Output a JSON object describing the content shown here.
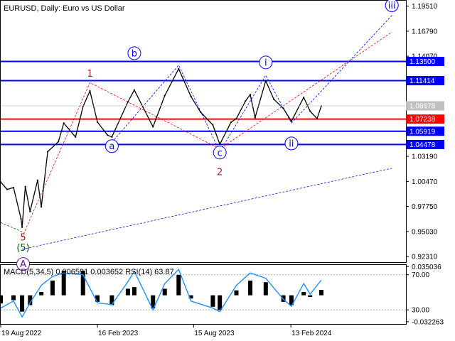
{
  "chart_data": [
    {
      "type": "line",
      "title": "EURUSD, Daily:  Euro vs US Dollar",
      "symbol": "EURUSD",
      "timeframe": "Daily",
      "description": "Euro vs US Dollar",
      "ylim": [
        0.917,
        1.201
      ],
      "x_start": "2022-08-19",
      "x_end": "2024-04-10",
      "y_ticks": [
        1.1951,
        1.1679,
        1.1407,
        1.1135,
        1.0863,
        1.0591,
        1.0319,
        1.0047,
        0.9775,
        0.9503,
        0.9231
      ],
      "x_ticks": [
        {
          "x": "2022-08-19",
          "label": "19 Aug 2022"
        },
        {
          "x": "2023-02-16",
          "label": "16 Feb 2023"
        },
        {
          "x": "2023-08-15",
          "label": "15 Aug 2023"
        },
        {
          "x": "2024-02-13",
          "label": "13 Feb 2024"
        }
      ],
      "price_series": [
        {
          "x": "2022-08-19",
          "y": 1.004
        },
        {
          "x": "2022-08-31",
          "y": 0.996
        },
        {
          "x": "2022-09-12",
          "y": 0.998
        },
        {
          "x": "2022-09-26",
          "y": 0.964
        },
        {
          "x": "2022-09-28",
          "y": 0.955
        },
        {
          "x": "2022-10-04",
          "y": 0.999
        },
        {
          "x": "2022-10-13",
          "y": 0.972
        },
        {
          "x": "2022-10-27",
          "y": 1.006
        },
        {
          "x": "2022-11-03",
          "y": 0.977
        },
        {
          "x": "2022-11-15",
          "y": 1.037
        },
        {
          "x": "2022-12-05",
          "y": 1.048
        },
        {
          "x": "2022-12-15",
          "y": 1.068
        },
        {
          "x": "2023-01-06",
          "y": 1.053
        },
        {
          "x": "2023-01-20",
          "y": 1.086
        },
        {
          "x": "2023-02-02",
          "y": 1.103
        },
        {
          "x": "2023-02-16",
          "y": 1.069
        },
        {
          "x": "2023-03-07",
          "y": 1.055
        },
        {
          "x": "2023-03-15",
          "y": 1.053
        },
        {
          "x": "2023-04-14",
          "y": 1.091
        },
        {
          "x": "2023-04-26",
          "y": 1.104
        },
        {
          "x": "2023-05-31",
          "y": 1.064
        },
        {
          "x": "2023-06-22",
          "y": 1.098
        },
        {
          "x": "2023-07-18",
          "y": 1.127
        },
        {
          "x": "2023-08-10",
          "y": 1.097
        },
        {
          "x": "2023-08-28",
          "y": 1.08
        },
        {
          "x": "2023-09-20",
          "y": 1.066
        },
        {
          "x": "2023-10-03",
          "y": 1.045
        },
        {
          "x": "2023-10-24",
          "y": 1.069
        },
        {
          "x": "2023-11-03",
          "y": 1.073
        },
        {
          "x": "2023-11-20",
          "y": 1.092
        },
        {
          "x": "2023-11-29",
          "y": 1.099
        },
        {
          "x": "2023-12-08",
          "y": 1.074
        },
        {
          "x": "2023-12-28",
          "y": 1.114
        },
        {
          "x": "2024-01-12",
          "y": 1.094
        },
        {
          "x": "2024-01-30",
          "y": 1.084
        },
        {
          "x": "2024-02-14",
          "y": 1.07
        },
        {
          "x": "2024-03-08",
          "y": 1.096
        },
        {
          "x": "2024-03-20",
          "y": 1.081
        },
        {
          "x": "2024-04-02",
          "y": 1.073
        },
        {
          "x": "2024-04-10",
          "y": 1.0867
        }
      ],
      "current_price": {
        "value": 1.08678,
        "label": "1.08678"
      },
      "levels": [
        {
          "value": 1.135,
          "label": "1.13500",
          "color": "#0000ff"
        },
        {
          "value": 1.11414,
          "label": "1.11414",
          "color": "#0000ff"
        },
        {
          "value": 1.07238,
          "label": "1.07238",
          "color": "#ff0000"
        },
        {
          "value": 1.05919,
          "label": "1.05919",
          "color": "#0000ff"
        },
        {
          "value": 1.04478,
          "label": "1.04478",
          "color": "#0000ff"
        }
      ],
      "wave_lines": [
        {
          "color": "#ff0000",
          "points": [
            [
              "2022-09-28",
              0.944
            ],
            [
              "2023-02-02",
              1.112
            ],
            [
              "2023-10-03",
              1.04
            ],
            [
              "2024-08-20",
              1.167
            ]
          ]
        },
        {
          "color": "#0000ff",
          "points": [
            [
              "2023-03-15",
              1.047
            ],
            [
              "2023-07-18",
              1.131
            ],
            [
              "2023-10-03",
              1.037
            ],
            [
              "2023-12-28",
              1.12
            ],
            [
              "2024-02-14",
              1.068
            ],
            [
              "2024-08-20",
              1.185
            ]
          ]
        },
        {
          "color": "#3300cc",
          "points": [
            [
              "2022-09-28",
              0.931
            ],
            [
              "2024-08-20",
              1.019
            ]
          ]
        },
        {
          "color": "#006400",
          "points": [
            [
              "2022-08-19",
              0.96
            ],
            [
              "2022-09-28",
              0.95
            ]
          ]
        }
      ],
      "wave_labels": [
        {
          "text": "1",
          "x": "2023-02-02",
          "y": 1.122,
          "color": "#b22222",
          "circled": false
        },
        {
          "text": "2",
          "x": "2023-10-03",
          "y": 1.015,
          "color": "#b22222",
          "circled": false
        },
        {
          "text": "5",
          "x": "2022-09-30",
          "y": 0.944,
          "color": "#b22222",
          "circled": false
        },
        {
          "text": "(5)",
          "x": "2022-09-30",
          "y": 0.933,
          "color": "#006400",
          "circled": false
        },
        {
          "text": "A",
          "x": "2022-09-30",
          "y": 0.915,
          "color": "#6a0dad",
          "circled": true
        },
        {
          "text": "a",
          "x": "2023-03-15",
          "y": 1.043,
          "color": "#0000ff",
          "circled": true
        },
        {
          "text": "b",
          "x": "2023-04-26",
          "y": 1.144,
          "color": "#0000ff",
          "circled": true
        },
        {
          "text": "c",
          "x": "2023-10-03",
          "y": 1.036,
          "color": "#0000ff",
          "circled": true
        },
        {
          "text": "i",
          "x": "2023-12-28",
          "y": 1.134,
          "color": "#0000ff",
          "circled": true
        },
        {
          "text": "ii",
          "x": "2024-02-14",
          "y": 1.046,
          "color": "#0000ff",
          "circled": true
        },
        {
          "text": "iii",
          "x": "2024-08-20",
          "y": 1.196,
          "color": "#0000ff",
          "circled": true
        }
      ]
    },
    {
      "type": "line",
      "title": "MACD(5,34,5) 0.006591 0.003652 RSI(14) 63.87",
      "macd_params": "MACD(5,34,5)",
      "macd_value": "0.006591",
      "signal_value": "0.003652",
      "rsi_params": "RSI(14)",
      "rsi_value": "63.87",
      "ylim": [
        -0.035,
        0.037
      ],
      "y_ticks": [
        {
          "value": 0.035036,
          "label": "0.035036"
        },
        {
          "value": 0.0251,
          "label": "70.00"
        },
        {
          "value": -0.0178,
          "label": "30.00"
        },
        {
          "value": -0.032263,
          "label": "-0.032263"
        }
      ],
      "macd_series": [
        {
          "x": "2022-08-19",
          "y": -0.01
        },
        {
          "x": "2022-09-12",
          "y": -0.006
        },
        {
          "x": "2022-09-28",
          "y": -0.02
        },
        {
          "x": "2022-10-13",
          "y": -0.012
        },
        {
          "x": "2022-11-03",
          "y": 0.004
        },
        {
          "x": "2022-11-24",
          "y": 0.018
        },
        {
          "x": "2022-12-15",
          "y": 0.03
        },
        {
          "x": "2023-01-20",
          "y": 0.03
        },
        {
          "x": "2023-02-16",
          "y": -0.008
        },
        {
          "x": "2023-03-15",
          "y": -0.012
        },
        {
          "x": "2023-04-14",
          "y": 0.008
        },
        {
          "x": "2023-04-26",
          "y": 0.01
        },
        {
          "x": "2023-05-31",
          "y": -0.016
        },
        {
          "x": "2023-06-22",
          "y": 0.008
        },
        {
          "x": "2023-07-18",
          "y": 0.025
        },
        {
          "x": "2023-08-10",
          "y": -0.004
        },
        {
          "x": "2023-09-20",
          "y": -0.014
        },
        {
          "x": "2023-10-03",
          "y": -0.018
        },
        {
          "x": "2023-11-03",
          "y": 0.006
        },
        {
          "x": "2023-11-29",
          "y": 0.018
        },
        {
          "x": "2023-12-28",
          "y": 0.016
        },
        {
          "x": "2024-01-30",
          "y": -0.008
        },
        {
          "x": "2024-02-14",
          "y": -0.012
        },
        {
          "x": "2024-03-08",
          "y": 0.004
        },
        {
          "x": "2024-03-20",
          "y": -0.002
        },
        {
          "x": "2024-04-10",
          "y": 0.0066
        }
      ],
      "rsi_series": [
        {
          "x": "2022-08-19",
          "y": 32
        },
        {
          "x": "2022-09-12",
          "y": 40
        },
        {
          "x": "2022-09-28",
          "y": 22
        },
        {
          "x": "2022-10-13",
          "y": 38
        },
        {
          "x": "2022-11-03",
          "y": 58
        },
        {
          "x": "2022-11-24",
          "y": 68
        },
        {
          "x": "2022-12-15",
          "y": 72
        },
        {
          "x": "2023-01-20",
          "y": 70
        },
        {
          "x": "2023-02-16",
          "y": 38
        },
        {
          "x": "2023-03-15",
          "y": 36
        },
        {
          "x": "2023-04-14",
          "y": 62
        },
        {
          "x": "2023-04-26",
          "y": 74
        },
        {
          "x": "2023-05-31",
          "y": 30
        },
        {
          "x": "2023-06-22",
          "y": 60
        },
        {
          "x": "2023-07-18",
          "y": 76
        },
        {
          "x": "2023-08-10",
          "y": 40
        },
        {
          "x": "2023-09-20",
          "y": 32
        },
        {
          "x": "2023-10-03",
          "y": 28
        },
        {
          "x": "2023-11-03",
          "y": 58
        },
        {
          "x": "2023-11-29",
          "y": 72
        },
        {
          "x": "2023-12-28",
          "y": 66
        },
        {
          "x": "2024-01-30",
          "y": 42
        },
        {
          "x": "2024-02-14",
          "y": 34
        },
        {
          "x": "2024-03-08",
          "y": 60
        },
        {
          "x": "2024-03-20",
          "y": 48
        },
        {
          "x": "2024-04-10",
          "y": 63.87
        }
      ],
      "colors": {
        "macd_bars": "#000000",
        "rsi_line": "#1e90ff"
      }
    }
  ]
}
